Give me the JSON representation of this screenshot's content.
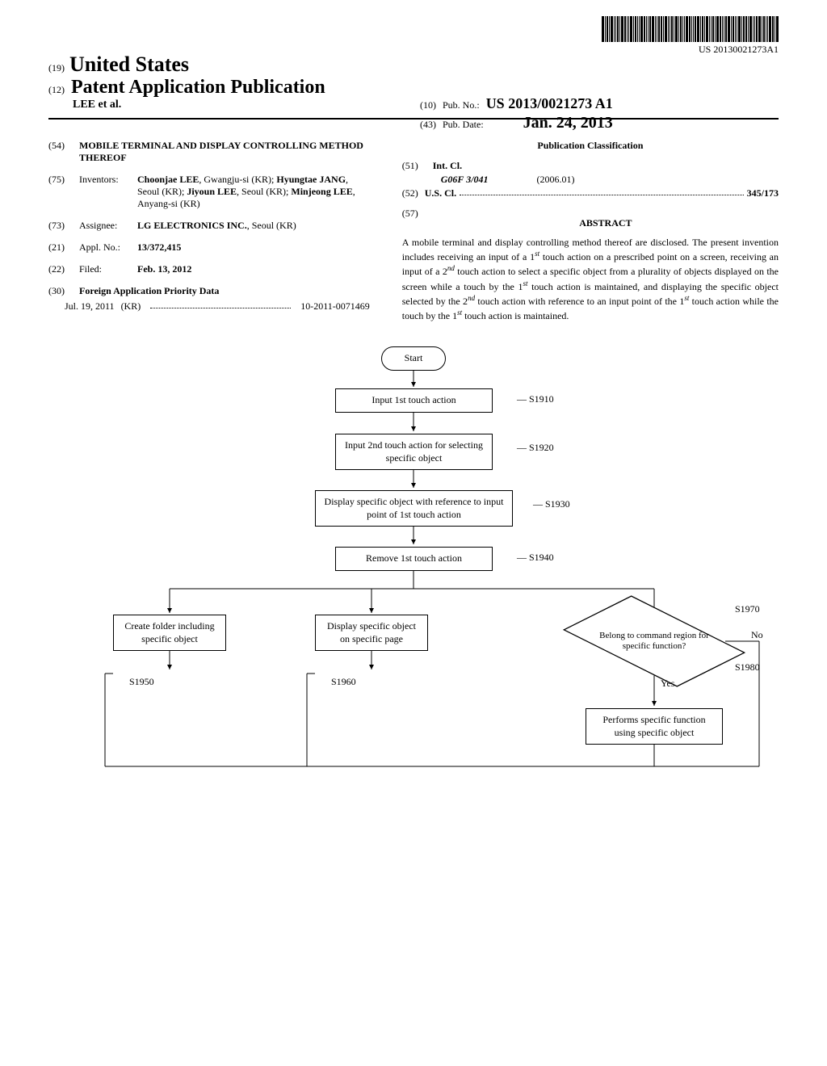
{
  "barcode_text": "US 20130021273A1",
  "header": {
    "kind_code_19": "(19)",
    "country": "United States",
    "kind_code_12": "(12)",
    "pub_type": "Patent Application Publication",
    "inventor_line": "LEE et al.",
    "pub_no_label_num": "(10)",
    "pub_no_label": "Pub. No.:",
    "pub_no_value": "US 2013/0021273 A1",
    "pub_date_label_num": "(43)",
    "pub_date_label": "Pub. Date:",
    "pub_date_value": "Jan. 24, 2013"
  },
  "fields": {
    "f54_num": "(54)",
    "f54_value": "MOBILE TERMINAL AND DISPLAY CONTROLLING METHOD THEREOF",
    "f75_num": "(75)",
    "f75_label": "Inventors:",
    "f75_value": "Choonjae LEE, Gwangju-si (KR); Hyungtae JANG, Seoul (KR); Jiyoun LEE, Seoul (KR); Minjeong LEE, Anyang-si (KR)",
    "f73_num": "(73)",
    "f73_label": "Assignee:",
    "f73_value": "LG ELECTRONICS INC., Seoul (KR)",
    "f21_num": "(21)",
    "f21_label": "Appl. No.:",
    "f21_value": "13/372,415",
    "f22_num": "(22)",
    "f22_label": "Filed:",
    "f22_value": "Feb. 13, 2012",
    "f30_num": "(30)",
    "f30_heading": "Foreign Application Priority Data",
    "priority_date": "Jul. 19, 2011",
    "priority_country": "(KR)",
    "priority_number": "10-2011-0071469"
  },
  "classification": {
    "heading": "Publication Classification",
    "f51_num": "(51)",
    "f51_label": "Int. Cl.",
    "f51_code": "G06F 3/041",
    "f51_date": "(2006.01)",
    "f52_num": "(52)",
    "f52_label": "U.S. Cl.",
    "f52_value": "345/173"
  },
  "abstract": {
    "num": "(57)",
    "heading": "ABSTRACT",
    "text": "A mobile terminal and display controlling method thereof are disclosed. The present invention includes receiving an input of a 1ˢᵗ touch action on a prescribed point on a screen, receiving an input of a 2ⁿᵈ touch action to select a specific object from a plurality of objects displayed on the screen while a touch by the 1ˢᵗ touch action is maintained, and displaying the specific object selected by the 2ⁿᵈ touch action with reference to an input point of the 1ˢᵗ touch action while the touch by the 1ˢᵗ touch action is maintained."
  },
  "flowchart": {
    "start": "Start",
    "s1910_box": "Input 1st touch action",
    "s1910": "S1910",
    "s1920_box": "Input 2nd touch action for selecting specific object",
    "s1920": "S1920",
    "s1930_box": "Display specific object with reference to input point of 1st touch action",
    "s1930": "S1930",
    "s1940_box": "Remove 1st touch action",
    "s1940": "S1940",
    "s1950_box": "Create folder including specific object",
    "s1950": "S1950",
    "s1960_box": "Display specific object on specific page",
    "s1960": "S1960",
    "s1970_box": "Belong to command region for specific function?",
    "s1970": "S1970",
    "s1980_box": "Performs specific function using specific object",
    "s1980": "S1980",
    "yes": "Yes",
    "no": "No"
  }
}
